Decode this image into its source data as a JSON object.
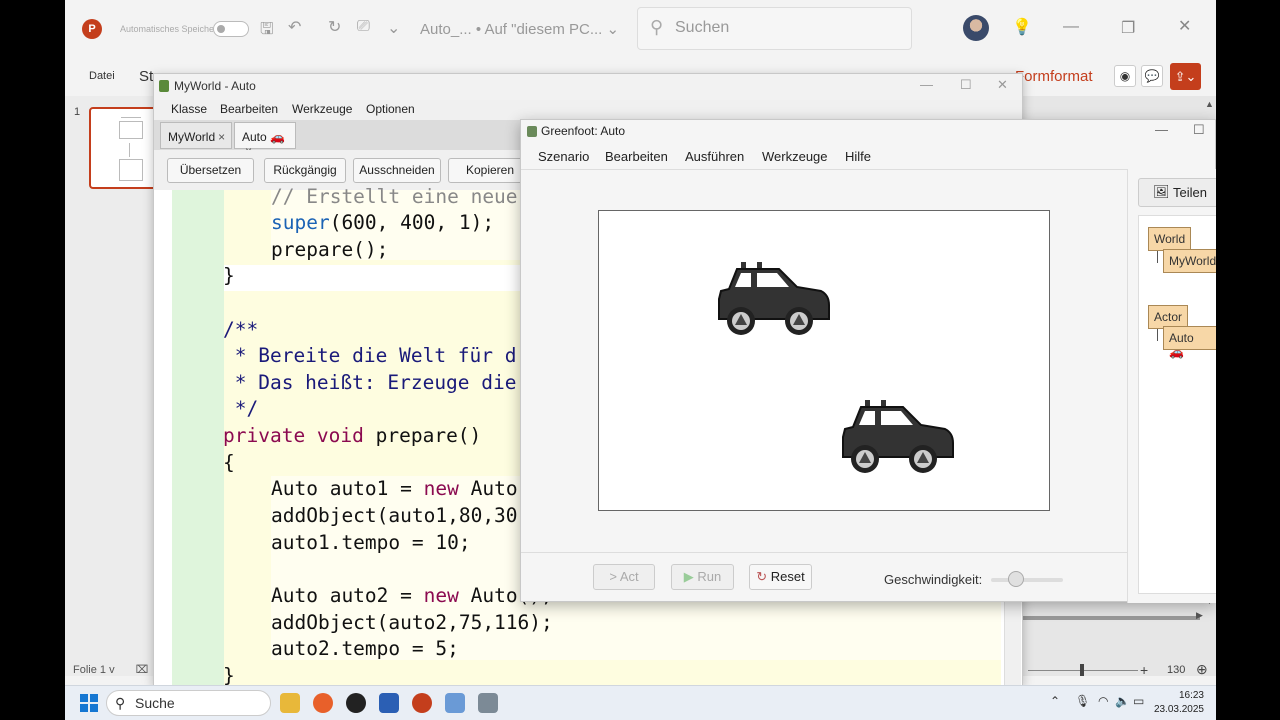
{
  "powerpoint": {
    "autosave_label": "Automatisches Speichern",
    "doc_title": "Auto_... • Auf \"diesem PC...",
    "search_placeholder": "Suchen",
    "tab_datei": "Datei",
    "tab_start": "St",
    "tab_formformat": "Formformat",
    "slide_number": "1",
    "status_slide": "Folie 1 v",
    "zoom_value": "130"
  },
  "bluej": {
    "window_title": "MyWorld - Auto",
    "menu": [
      "Klasse",
      "Bearbeiten",
      "Werkzeuge",
      "Optionen"
    ],
    "tabs": [
      {
        "label": "MyWorld",
        "close": "×"
      },
      {
        "label": "Auto 🚗",
        "close": "×"
      }
    ],
    "toolbar": [
      "Übersetzen",
      "Rückgängig",
      "Ausschneiden",
      "Kopieren"
    ],
    "code": {
      "l1": "// Erstellt eine neue",
      "l2a": "super",
      "l2b": "(600, 400, 1);",
      "l3": "prepare();",
      "l4": "}",
      "l5": "/**",
      "l6": " * Bereite die Welt für d",
      "l7": " * Das heißt: Erzeuge die",
      "l8": " */",
      "l9a": "private void",
      "l9b": " prepare()",
      "l10": "{",
      "l11a": "Auto auto1 = ",
      "l11b": "new",
      "l11c": " Auto",
      "l12": "addObject(auto1,80,30",
      "l13": "auto1.tempo = 10;",
      "l14a": "Auto auto2 = ",
      "l14b": "new",
      "l14c": " Auto();",
      "l15": "addObject(auto2,75,116);",
      "l16": "auto2.tempo = 5;",
      "l17": "}"
    }
  },
  "greenfoot": {
    "window_title": "Greenfoot: Auto",
    "menu": [
      "Szenario",
      "Bearbeiten",
      "Ausführen",
      "Werkzeuge",
      "Hilfe"
    ],
    "act_label": "Act",
    "run_label": "Run",
    "reset_label": "Reset",
    "speed_label": "Geschwindigkeit:",
    "speed_value": 0.35,
    "share_label": "Teilen",
    "classes": [
      "World",
      "MyWorld",
      "Actor",
      "Auto 🚗"
    ]
  },
  "taskbar": {
    "search_label": "Suche",
    "time": "16:23",
    "date": "23.03.2025"
  }
}
